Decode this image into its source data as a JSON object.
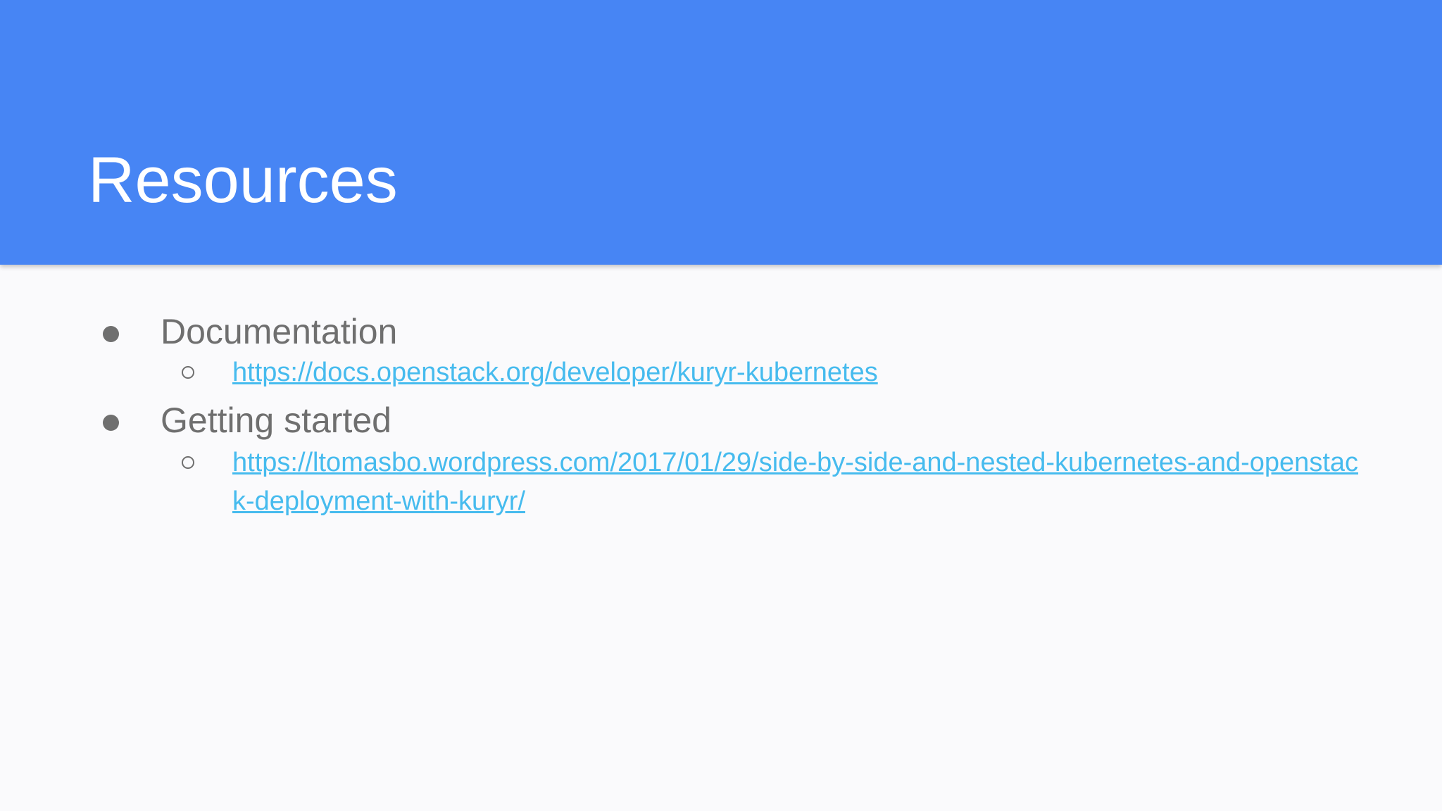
{
  "slide": {
    "title": "Resources",
    "items": [
      {
        "label": "Documentation",
        "links": [
          "https://docs.openstack.org/developer/kuryr-kubernetes"
        ]
      },
      {
        "label": "Getting started",
        "links": [
          "https://ltomasbo.wordpress.com/2017/01/29/side-by-side-and-nested-kubernetes-and-openstack-deployment-with-kuryr/"
        ]
      }
    ]
  },
  "colors": {
    "header": "#4785f4",
    "background": "#fafafc",
    "text": "#6f6f6f",
    "link": "#46bbee"
  }
}
